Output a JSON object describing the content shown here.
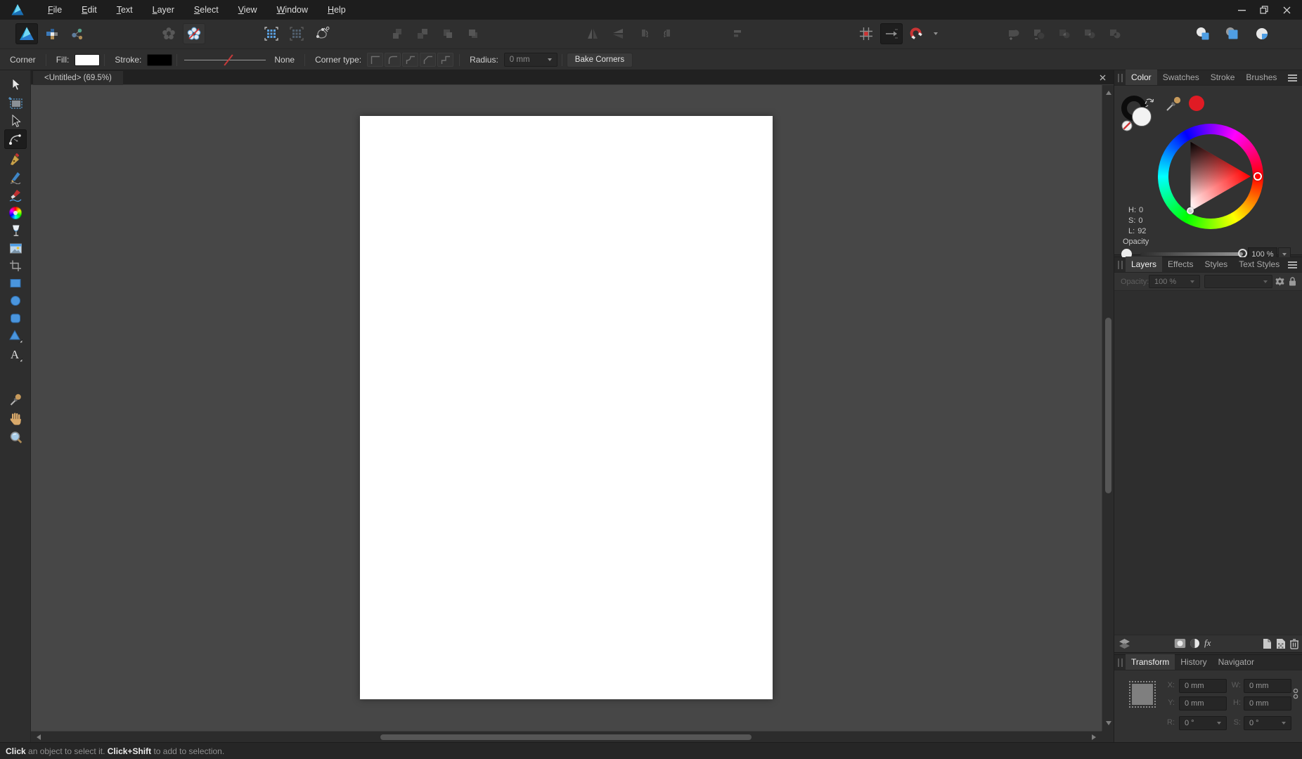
{
  "titlebar": {
    "menu_items": [
      "File",
      "Edit",
      "Text",
      "Layer",
      "Select",
      "View",
      "Window",
      "Help"
    ]
  },
  "toolbar": {
    "icon_names": [
      "designer-persona",
      "pixel-persona",
      "export-persona",
      "insert-inside-flower",
      "insert-target-off-flower",
      "snap-grid-on",
      "snap-grid-off",
      "snap-candidates",
      "arrange-1",
      "arrange-2",
      "arrange-3",
      "arrange-4",
      "flip-horizontal",
      "flip-vertical",
      "rotate-ccw",
      "rotate-cw",
      "alignment",
      "show-pixel-grid",
      "move-by-whole-pixels",
      "snapping-magnet",
      "boolean-add",
      "boolean-subtract",
      "boolean-intersect",
      "boolean-divide",
      "boolean-combine",
      "insert-behind",
      "insert-inside-target",
      "insert-on-top"
    ]
  },
  "context_toolbar": {
    "tool_label": "Corner",
    "fill_label": "Fill:",
    "stroke_label": "Stroke:",
    "stroke_style_value": "None",
    "corner_type_label": "Corner type:",
    "radius_label": "Radius:",
    "radius_value": "0 mm",
    "bake_button": "Bake Corners",
    "fill_color": "#ffffff",
    "stroke_color": "#000000"
  },
  "document": {
    "tab_title": "<Untitled> (69.5%)"
  },
  "tools": {
    "names": [
      "move-tool",
      "artboard-tool",
      "node-tool",
      "corner-tool",
      "pen-tool",
      "pencil-tool",
      "vector-brush-tool",
      "fill-tool",
      "transparency-tool",
      "place-image-tool",
      "vector-crop-tool",
      "rectangle-tool",
      "ellipse-tool",
      "rounded-rectangle-tool",
      "triangle-tool",
      "artistic-text-tool",
      "color-picker-tool",
      "view-tool",
      "zoom-tool"
    ],
    "selected": "corner-tool",
    "text_tool_glyph": "A"
  },
  "panels": {
    "color": {
      "tabs": [
        "Color",
        "Swatches",
        "Stroke",
        "Brushes"
      ],
      "active_tab": "Color",
      "h_label": "H:",
      "h_value": "0",
      "s_label": "S:",
      "s_value": "0",
      "l_label": "L:",
      "l_value": "92",
      "opacity_label": "Opacity",
      "opacity_value": "100 %",
      "swatch_red": "#e01b24"
    },
    "layers": {
      "tabs": [
        "Layers",
        "Effects",
        "Styles",
        "Text Styles"
      ],
      "active_tab": "Layers",
      "opacity_label": "Opacity:",
      "opacity_value": "100 %",
      "fx_label": "fx"
    },
    "transform": {
      "tabs": [
        "Transform",
        "History",
        "Navigator"
      ],
      "active_tab": "Transform",
      "x_label": "X:",
      "x_value": "0 mm",
      "y_label": "Y:",
      "y_value": "0 mm",
      "w_label": "W:",
      "w_value": "0 mm",
      "h_label": "H:",
      "h_value": "0 mm",
      "r_label": "R:",
      "r_value": "0 °",
      "s_label": "S:",
      "s_value": "0 °"
    }
  },
  "status_bar": {
    "bold1": "Click",
    "text1": " an object to select it. ",
    "bold2": "Click+Shift",
    "text2": " to add to selection."
  },
  "colors": {
    "accent_blue": "#4f9ee3",
    "canvas_grey": "#474747",
    "panel_grey": "#323232"
  }
}
